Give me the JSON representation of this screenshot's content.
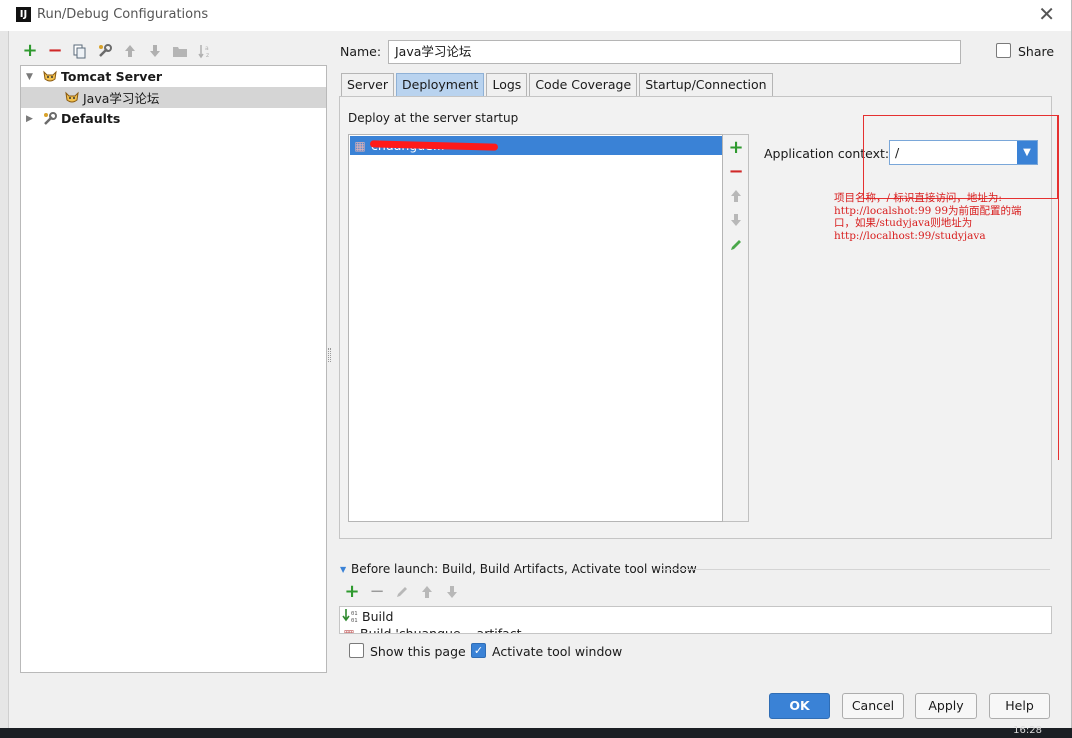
{
  "window": {
    "title": "Run/Debug Configurations",
    "app_icon_text": "IJ",
    "close_glyph": "✕"
  },
  "toolbar": {
    "icons": [
      "add-icon",
      "remove-icon",
      "copy-icon",
      "edit-defaults-icon",
      "move-up-icon",
      "move-down-icon",
      "folder-icon",
      "sort-icon"
    ]
  },
  "tree": {
    "items": [
      {
        "label": "Tomcat Server",
        "level": 0,
        "expanded": true
      },
      {
        "label": "Java学习论坛",
        "level": 1,
        "selected": true
      },
      {
        "label": "Defaults",
        "level": 0,
        "expanded": false
      }
    ]
  },
  "form": {
    "name_label": "Name:",
    "name_value": "Java学习论坛",
    "share_label": "Share",
    "share_checked": false
  },
  "tabs": [
    {
      "label": "Server",
      "active": false
    },
    {
      "label": "Deployment",
      "active": true
    },
    {
      "label": "Logs",
      "active": false
    },
    {
      "label": "Code Coverage",
      "active": false
    },
    {
      "label": "Startup/Connection",
      "active": false
    }
  ],
  "deployment": {
    "section_title": "Deploy at the server startup",
    "artifact_label": "chuangue...",
    "context_label": "Application context:",
    "context_value": "/"
  },
  "annotation": {
    "lines": [
      "项目名称，/ 标识直接访问，地址为:",
      "http://localshot:99  99为前面配置的端",
      "口，如果/studyjava则地址为",
      "http://localhost:99/studyjava"
    ]
  },
  "before_launch": {
    "label": "Before launch: Build, Build Artifacts, Activate tool window",
    "items": [
      "Build",
      "Build 'chuangue... artifact"
    ]
  },
  "options": {
    "show_page_label": "Show this page",
    "show_page_checked": false,
    "activate_label": "Activate tool window",
    "activate_checked": true
  },
  "buttons": {
    "ok": "OK",
    "cancel": "Cancel",
    "apply": "Apply",
    "help": "Help"
  },
  "taskbar": {
    "clock": "16:28"
  },
  "colors": {
    "selection": "#3a82d6",
    "annotation": "#d81e1e",
    "tab_active": "#b9d3ef"
  }
}
